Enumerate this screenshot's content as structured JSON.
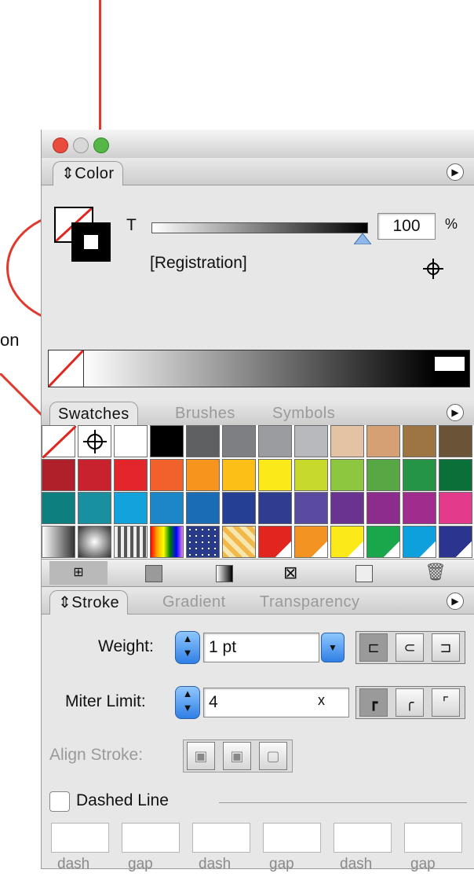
{
  "callout_fragment": "on",
  "color_panel": {
    "tab_label": "Color",
    "tint_label": "T",
    "tint_value": "100",
    "percent_label": "%",
    "swatch_name": "[Registration]"
  },
  "swatches_panel": {
    "tabs": [
      "Swatches",
      "Brushes",
      "Symbols"
    ],
    "rows": [
      [
        "none",
        "registration",
        "#ffffff",
        "#000000",
        "#5f6062",
        "#7e7f82",
        "#9b9c9f",
        "#b7b9bc",
        "#e3c3a3",
        "#d4a074",
        "#9d7542",
        "#6b5337"
      ],
      [
        "#b0202a",
        "#c8222f",
        "#e3262b",
        "#f0612b",
        "#f6941e",
        "#fbbf18",
        "#fbe919",
        "#c7d92c",
        "#8dc63f",
        "#57a844",
        "#259447",
        "#0b6f3a"
      ],
      [
        "#0d7f7f",
        "#1990a0",
        "#12a3dc",
        "#1c87c8",
        "#1a6db5",
        "#243f93",
        "#2e3d8f",
        "#5a4aa0",
        "#69338f",
        "#8c2c8d",
        "#a02c8e",
        "#e43a8c"
      ],
      [
        "pattern-grad-gray",
        "pattern-grad-radial",
        "pattern-grad-bars",
        "pattern-rainbow",
        "pattern-stars",
        "pattern-tiles",
        "pattern-red-corner",
        "pattern-orange-corner",
        "pattern-yellow-corner",
        "pattern-green-corner",
        "pattern-cyan-corner",
        "pattern-navy-corner"
      ]
    ]
  },
  "stroke_panel": {
    "tabs": [
      "Stroke",
      "Gradient",
      "Transparency"
    ],
    "weight_label": "Weight:",
    "weight_value": "1 pt",
    "miter_label": "Miter Limit:",
    "miter_value": "4",
    "miter_unit": "x",
    "align_label": "Align Stroke:",
    "dashed_label": "Dashed Line",
    "dash_labels": [
      "dash",
      "gap",
      "dash",
      "gap",
      "dash",
      "gap"
    ]
  },
  "colors": {
    "annotation": "#e03a2c",
    "accent_blue": "#2f7fe6"
  },
  "icons": [
    "menu-arrow-icon",
    "registration-target-icon",
    "tint-slider-triangle-icon",
    "stepper-arrows-icon",
    "dropdown-arrow-icon",
    "cap-butt-icon",
    "cap-round-icon",
    "cap-projecting-icon",
    "join-miter-icon",
    "join-round-icon",
    "join-bevel-icon",
    "align-center-icon",
    "align-inside-icon",
    "align-outside-icon",
    "trash-icon"
  ]
}
